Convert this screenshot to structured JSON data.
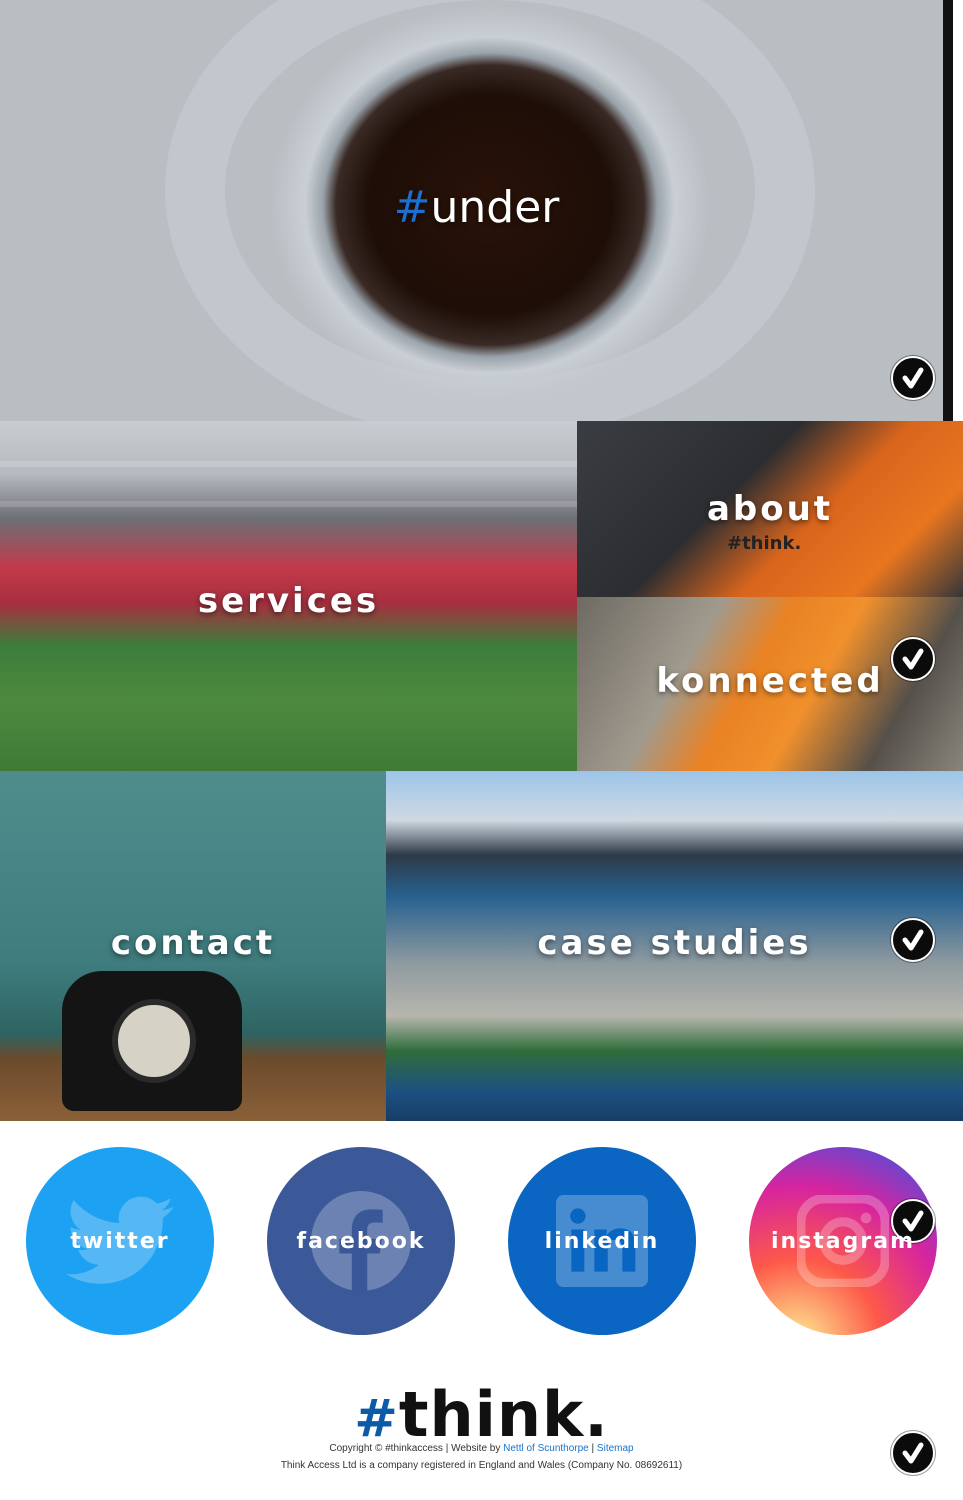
{
  "hero": {
    "hash": "#",
    "word": "under"
  },
  "tiles": {
    "services": "services",
    "about": "about",
    "about_shirt": "#think.",
    "konnected": "konnected",
    "contact": "contact",
    "case_studies": "case studies"
  },
  "social": {
    "twitter": "twitter",
    "facebook": "facebook",
    "linkedin": "linkedin",
    "instagram": "instagram"
  },
  "footer": {
    "logo_hash": "#",
    "logo_word": "think.",
    "copyright": "Copyright © #thinkaccess | Website by",
    "nettl_link": "Nettl of Scunthorpe",
    "sep": "|",
    "sitemap_link": "Sitemap",
    "company": "Think Access Ltd is a company registered in England and Wales (Company No. 08692611)"
  },
  "icons": {
    "badge": "check-badge-icon",
    "twitter": "twitter-bird-icon",
    "facebook": "facebook-f-icon",
    "linkedin": "linkedin-in-icon",
    "instagram": "instagram-camera-icon"
  },
  "colors": {
    "hash_blue": "#1a6fd0",
    "twitter": "#1da1f2",
    "facebook": "#3b5998",
    "linkedin": "#0a66c2",
    "link": "#1a73c9"
  }
}
